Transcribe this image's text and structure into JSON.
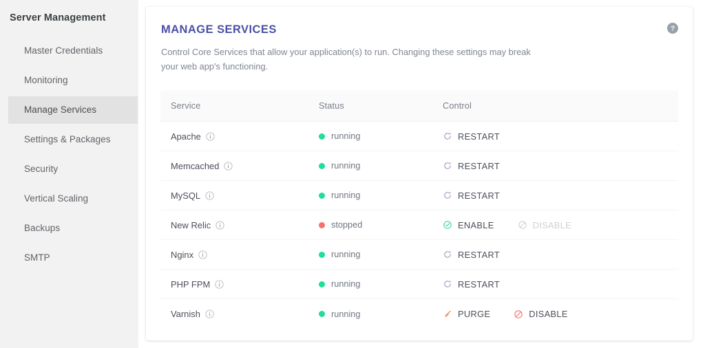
{
  "sidebar": {
    "title": "Server Management",
    "items": [
      {
        "label": "Master Credentials",
        "active": false
      },
      {
        "label": "Monitoring",
        "active": false
      },
      {
        "label": "Manage Services",
        "active": true
      },
      {
        "label": "Settings & Packages",
        "active": false
      },
      {
        "label": "Security",
        "active": false
      },
      {
        "label": "Vertical Scaling",
        "active": false
      },
      {
        "label": "Backups",
        "active": false
      },
      {
        "label": "SMTP",
        "active": false
      }
    ]
  },
  "card": {
    "title": "MANAGE SERVICES",
    "subtitle": "Control Core Services that allow your application(s) to run. Changing these settings may break your web app's functioning.",
    "help_icon": "help-circle-icon"
  },
  "table": {
    "columns": [
      "Service",
      "Status",
      "Control"
    ],
    "rows": [
      {
        "service": "Apache",
        "info_icon": "info-icon",
        "status": "running",
        "status_state": "running",
        "controls": [
          {
            "label": "RESTART",
            "icon": "restart-icon",
            "state": "enabled"
          }
        ]
      },
      {
        "service": "Memcached",
        "info_icon": "info-icon",
        "status": "running",
        "status_state": "running",
        "controls": [
          {
            "label": "RESTART",
            "icon": "restart-icon",
            "state": "enabled"
          }
        ]
      },
      {
        "service": "MySQL",
        "info_icon": "info-icon",
        "status": "running",
        "status_state": "running",
        "controls": [
          {
            "label": "RESTART",
            "icon": "restart-icon",
            "state": "enabled"
          }
        ]
      },
      {
        "service": "New Relic",
        "info_icon": "info-icon",
        "status": "stopped",
        "status_state": "stopped",
        "controls": [
          {
            "label": "ENABLE",
            "icon": "check-circle-icon",
            "state": "enabled"
          },
          {
            "label": "DISABLE",
            "icon": "block-icon",
            "state": "disabled"
          }
        ]
      },
      {
        "service": "Nginx",
        "info_icon": "info-icon",
        "status": "running",
        "status_state": "running",
        "controls": [
          {
            "label": "RESTART",
            "icon": "restart-icon",
            "state": "enabled"
          }
        ]
      },
      {
        "service": "PHP FPM",
        "info_icon": "info-icon",
        "status": "running",
        "status_state": "running",
        "controls": [
          {
            "label": "RESTART",
            "icon": "restart-icon",
            "state": "enabled"
          }
        ]
      },
      {
        "service": "Varnish",
        "info_icon": "info-icon",
        "status": "running",
        "status_state": "running",
        "controls": [
          {
            "label": "PURGE",
            "icon": "broom-icon",
            "state": "enabled"
          },
          {
            "label": "DISABLE",
            "icon": "block-icon",
            "state": "enabled"
          }
        ]
      }
    ]
  },
  "colors": {
    "title": "#4b4fa6",
    "running": "#1fdd9a",
    "stopped": "#f4736b",
    "restart_icon": "#b49cc4",
    "enable_icon": "#3ed6a3",
    "purge_icon": "#f08b52",
    "disable_icon": "#f4736b",
    "disabled_text": "#cdd0d6",
    "sidebar_bg": "#f2f2f2",
    "sidebar_active_bg": "#e2e2e2"
  }
}
